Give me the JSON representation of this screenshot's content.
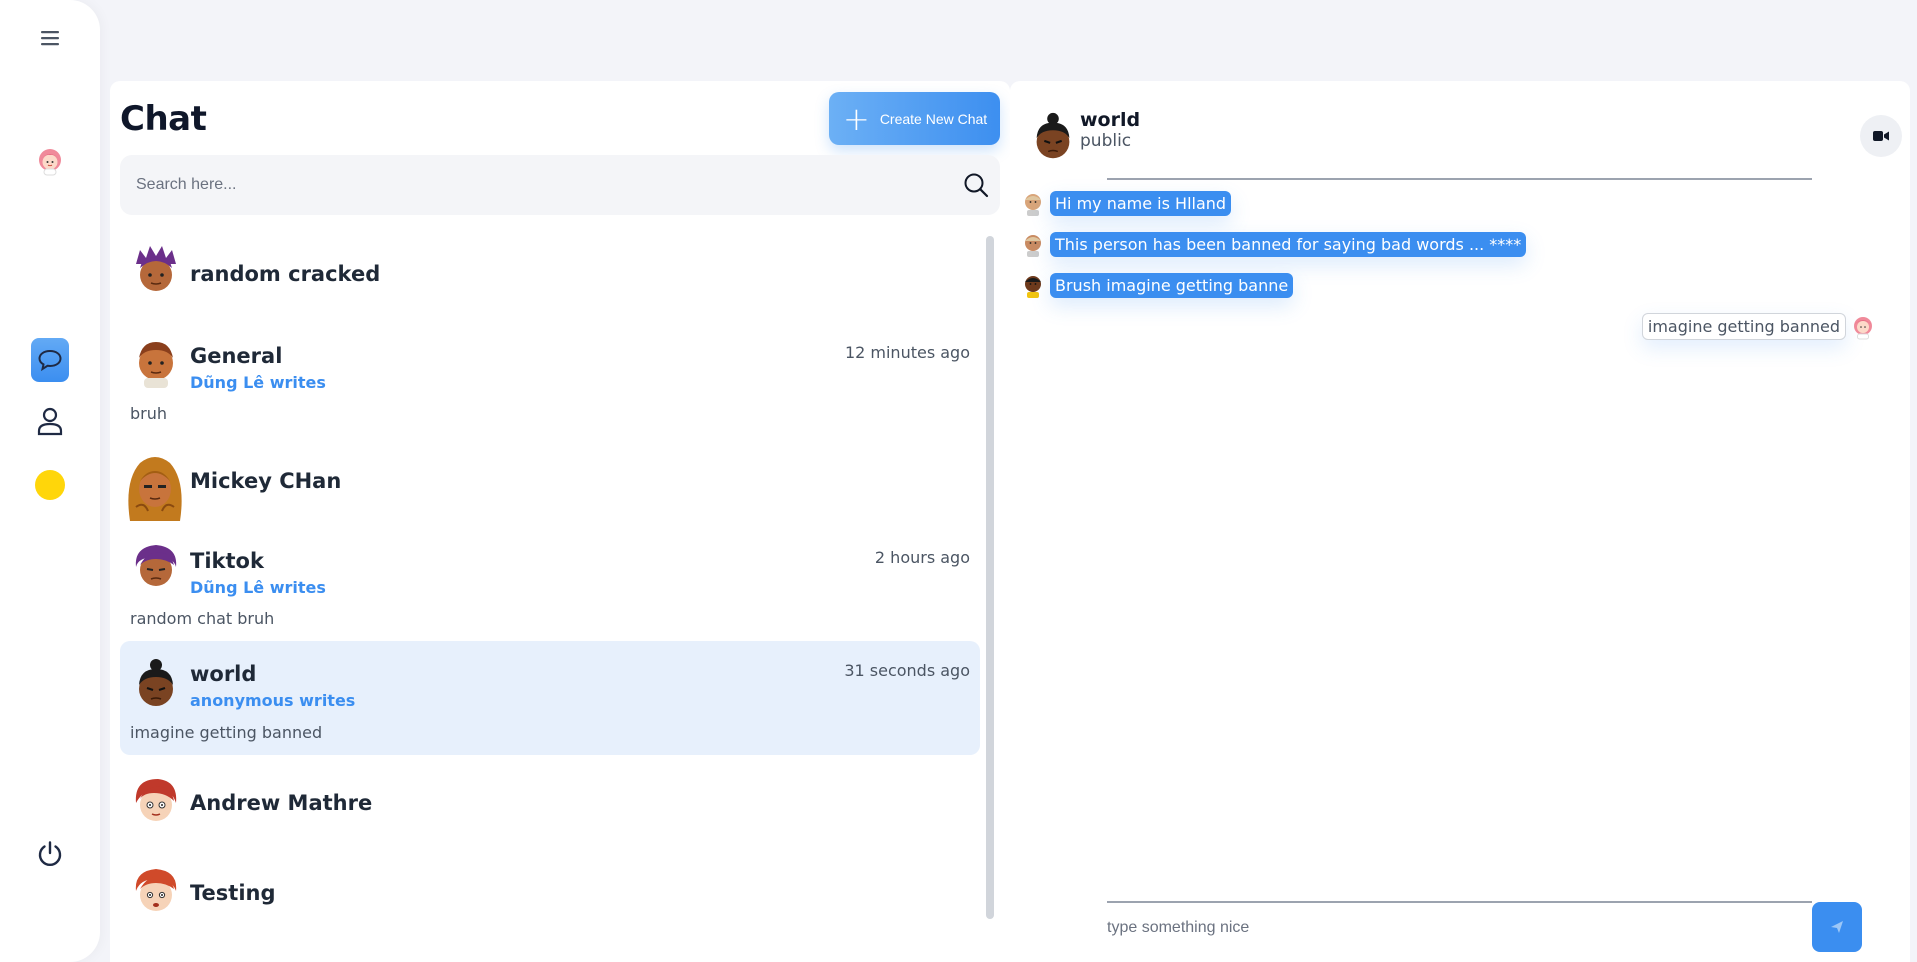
{
  "sidebar": {
    "menu_icon": "hamburger-menu-icon",
    "profile_avatar": "user-avatar-pink-hair",
    "nav_chat_icon": "chat-bubble-icon",
    "nav_user_icon": "person-icon",
    "status_color": "#ffd60a",
    "power_icon": "power-icon",
    "accent": "#3b8ef0"
  },
  "list": {
    "title": "Chat",
    "create_button": "Create New Chat",
    "search_placeholder": "Search here...",
    "chats": [
      {
        "name": "random cracked",
        "writer": "",
        "time": "",
        "preview": "",
        "active": false
      },
      {
        "name": "General",
        "writer": "Dũng Lê writes",
        "time": "12 minutes ago",
        "preview": "bruh",
        "active": false
      },
      {
        "name": "Mickey CHan",
        "writer": "",
        "time": "",
        "preview": "",
        "active": false
      },
      {
        "name": "Tiktok",
        "writer": "Dũng Lê writes",
        "time": "2 hours ago",
        "preview": "random chat bruh",
        "active": false
      },
      {
        "name": "world",
        "writer": "anonymous writes",
        "time": "31 seconds ago",
        "preview": "imagine getting banned",
        "active": true
      },
      {
        "name": "Andrew Mathre",
        "writer": "",
        "time": "",
        "preview": "",
        "active": false
      },
      {
        "name": "Testing",
        "writer": "",
        "time": "",
        "preview": "",
        "active": false
      }
    ]
  },
  "conversation": {
    "name": "world",
    "subtitle": "public",
    "video_icon": "video-camera-icon",
    "messages": [
      {
        "text": "Hi my name is Hlland",
        "outgoing": false
      },
      {
        "text": "This person has been banned for saying bad words ... ****",
        "outgoing": false
      },
      {
        "text": "Brush imagine getting banne",
        "outgoing": false
      },
      {
        "text": "imagine getting banned",
        "outgoing": true
      }
    ],
    "input_placeholder": "type something nice",
    "send_icon": "send-icon"
  }
}
